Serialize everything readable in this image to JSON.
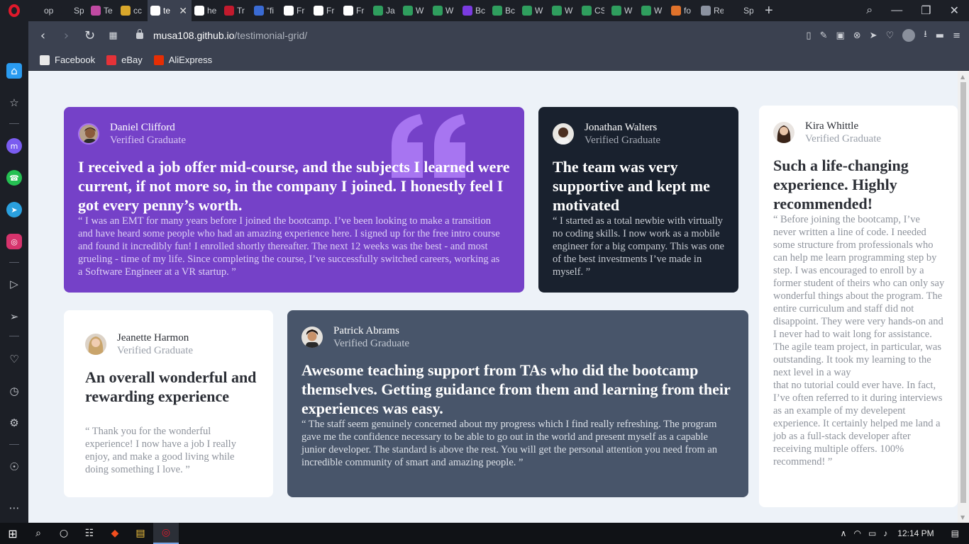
{
  "browser": {
    "tabs": [
      {
        "label": "op",
        "color": "#1c1f26"
      },
      {
        "label": "Sp",
        "color": "#1c1f26"
      },
      {
        "label": "Te",
        "color": "#c14aa3"
      },
      {
        "label": "cc",
        "color": "#d9a72b"
      },
      {
        "label": "te",
        "color": "#ffffff"
      },
      {
        "label": "he",
        "color": "#ffffff"
      },
      {
        "label": "Tr",
        "color": "#c21a2d"
      },
      {
        "label": "“fi",
        "color": "#3a6bd4"
      },
      {
        "label": "Fr",
        "color": "#ffffff"
      },
      {
        "label": "Fr",
        "color": "#ffffff"
      },
      {
        "label": "Fr",
        "color": "#ffffff"
      },
      {
        "label": "Ja",
        "color": "#2f9e5e"
      },
      {
        "label": "W",
        "color": "#2f9e5e"
      },
      {
        "label": "W",
        "color": "#2f9e5e"
      },
      {
        "label": "Bc",
        "color": "#7a3be0"
      },
      {
        "label": "Bc",
        "color": "#2f9e5e"
      },
      {
        "label": "W",
        "color": "#2f9e5e"
      },
      {
        "label": "W",
        "color": "#2f9e5e"
      },
      {
        "label": "CS",
        "color": "#2f9e5e"
      },
      {
        "label": "W",
        "color": "#2f9e5e"
      },
      {
        "label": "W",
        "color": "#2f9e5e"
      },
      {
        "label": "fo",
        "color": "#e0722b"
      },
      {
        "label": "Re",
        "color": "#8b92a0"
      },
      {
        "label": "Sp",
        "color": "#1c1f26"
      }
    ],
    "active_tab_index": 4,
    "url_domain": "musa108.github.io",
    "url_path": "/testimonial-grid/",
    "bookmarks": [
      {
        "label": "Facebook",
        "color": "#e8e8e8"
      },
      {
        "label": "eBay",
        "color": "#e53238"
      },
      {
        "label": "AliExpress",
        "color": "#e62e04"
      }
    ],
    "clock": "12:14 PM"
  },
  "testimonials": [
    {
      "name": "Daniel Clifford",
      "role": "Verified Graduate",
      "headline": "I received a job offer mid-course, and the subjects I learned were current, if not more so, in the company I joined. I honestly feel I got every penny’s worth.",
      "quote": "“ I was an EMT for many years before I joined the bootcamp. I’ve been looking to make a transition and have heard some people who had an amazing experience here. I signed up for the free intro course and found it incredibly fun! I enrolled shortly thereafter. The next 12 weeks was the best - and most grueling - time of my life. Since completing the course, I’ve successfully switched careers, working as a Software Engineer at a VR startup. ”",
      "bg": "#7541c8"
    },
    {
      "name": "Jonathan Walters",
      "role": "Verified Graduate",
      "headline": "The team was very supportive and kept me motivated",
      "quote": "“ I started as a total newbie with virtually no coding skills. I now work as a mobile engineer for a big company. This was one of the best investments I’ve made in myself. ”",
      "bg": "#19212e"
    },
    {
      "name": "Kira Whittle",
      "role": "Verified Graduate",
      "headline": "Such a life-changing experience. Highly recommended!",
      "quote": "“ Before joining the bootcamp, I’ve never written a line of code. I needed some structure from professionals who can help me learn programming step by step. I was encouraged to enroll by a former student of theirs who can only say wonderful things about the program. The entire curriculum and staff did not disappoint. They were very hands-on and I never had to wait long for assistance. The agile team project, in particular, was outstanding. It took my learning to the next level in a way",
      "quote_cont": "that no tutorial could ever have. In fact, I’ve often referred to it during interviews as an example of my develepent experience. It certainly helped me land a job as a full-stack developer after receiving multiple offers. 100% recommend! ”",
      "bg": "#ffffff"
    },
    {
      "name": "Jeanette Harmon",
      "role": "Verified Graduate",
      "headline": "An overall wonderful and rewarding experience",
      "quote": "“ Thank you for the wonderful experience! I now have a job I really enjoy, and make a good living while doing something I love. ”",
      "bg": "#ffffff"
    },
    {
      "name": "Patrick Abrams",
      "role": "Verified Graduate",
      "headline": "Awesome teaching support from TAs who did the bootcamp themselves. Getting guidance from them and learning from their experiences was easy.",
      "quote": "“ The staff seem genuinely concerned about my progress which I find really refreshing. The program gave me the confidence necessary to be able to go out in the world and present myself as a capable junior developer. The standard is above the rest. You will get the personal attention you need from an incredible community of smart and amazing people. ”",
      "bg": "#48556a"
    }
  ]
}
